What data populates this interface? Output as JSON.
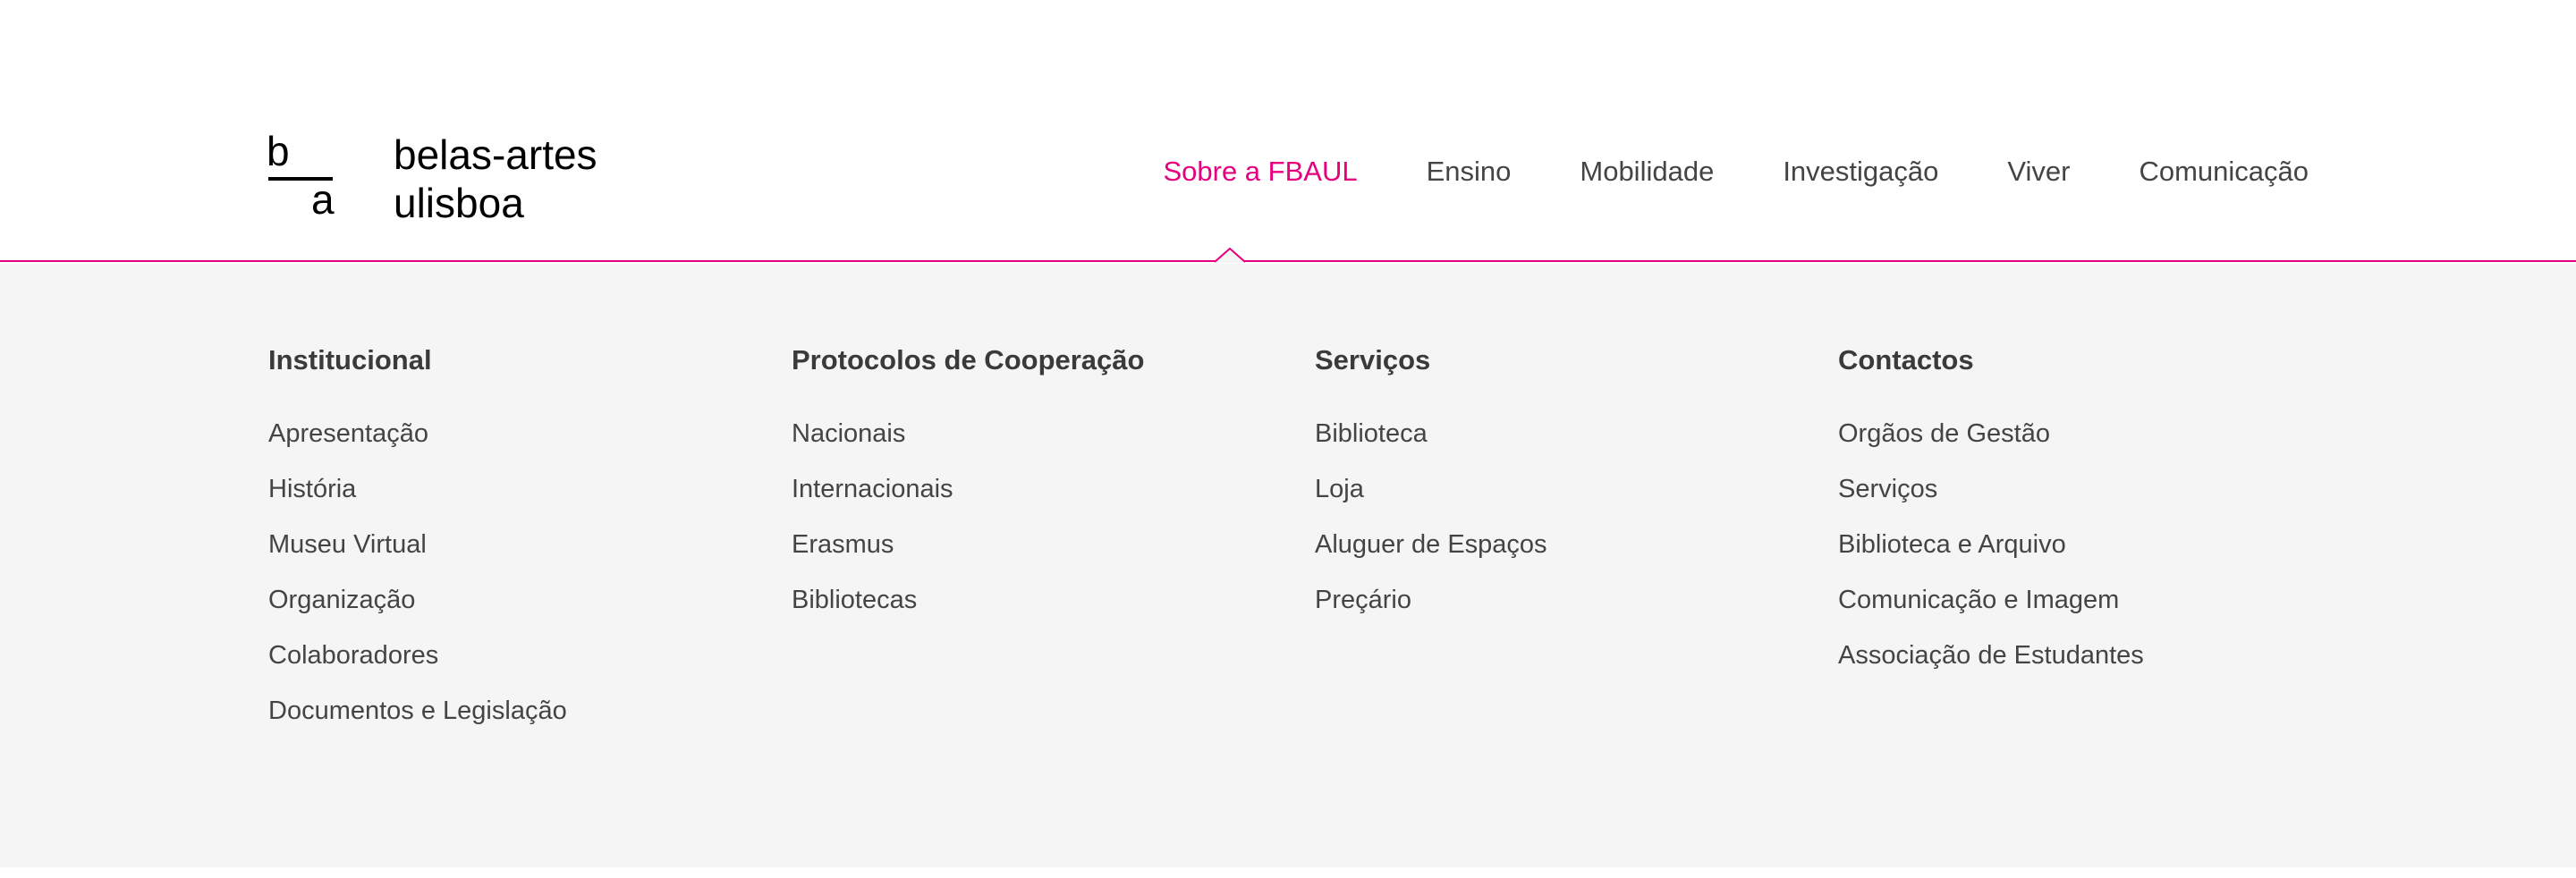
{
  "logo": {
    "mark_top": "b",
    "mark_bottom": "a",
    "line1": "belas-artes",
    "line2": "ulisboa"
  },
  "nav": {
    "items": [
      {
        "label": "Sobre a FBAUL",
        "active": true
      },
      {
        "label": "Ensino"
      },
      {
        "label": "Mobilidade"
      },
      {
        "label": "Investigação"
      },
      {
        "label": "Viver"
      },
      {
        "label": "Comunicação"
      }
    ]
  },
  "menu": {
    "columns": [
      {
        "title": "Institucional",
        "links": [
          "Apresentação",
          "História",
          "Museu Virtual",
          "Organização",
          "Colaboradores",
          "Documentos e Legislação"
        ]
      },
      {
        "title": "Protocolos de Cooperação",
        "links": [
          "Nacionais",
          "Internacionais",
          "Erasmus",
          "Bibliotecas"
        ]
      },
      {
        "title": "Serviços",
        "links": [
          "Biblioteca",
          "Loja",
          "Aluguer de Espaços",
          "Preçário"
        ]
      },
      {
        "title": "Contactos",
        "links": [
          "Orgãos de Gestão",
          "Serviços",
          "Biblioteca e Arquivo",
          "Comunicação e Imagem",
          "Associação de Estudantes"
        ]
      }
    ]
  },
  "colors": {
    "accent": "#e6007e",
    "menu_background": "#f5f5f5",
    "text": "#444444"
  },
  "icons": {
    "active_indicator": "caret-up-icon"
  }
}
